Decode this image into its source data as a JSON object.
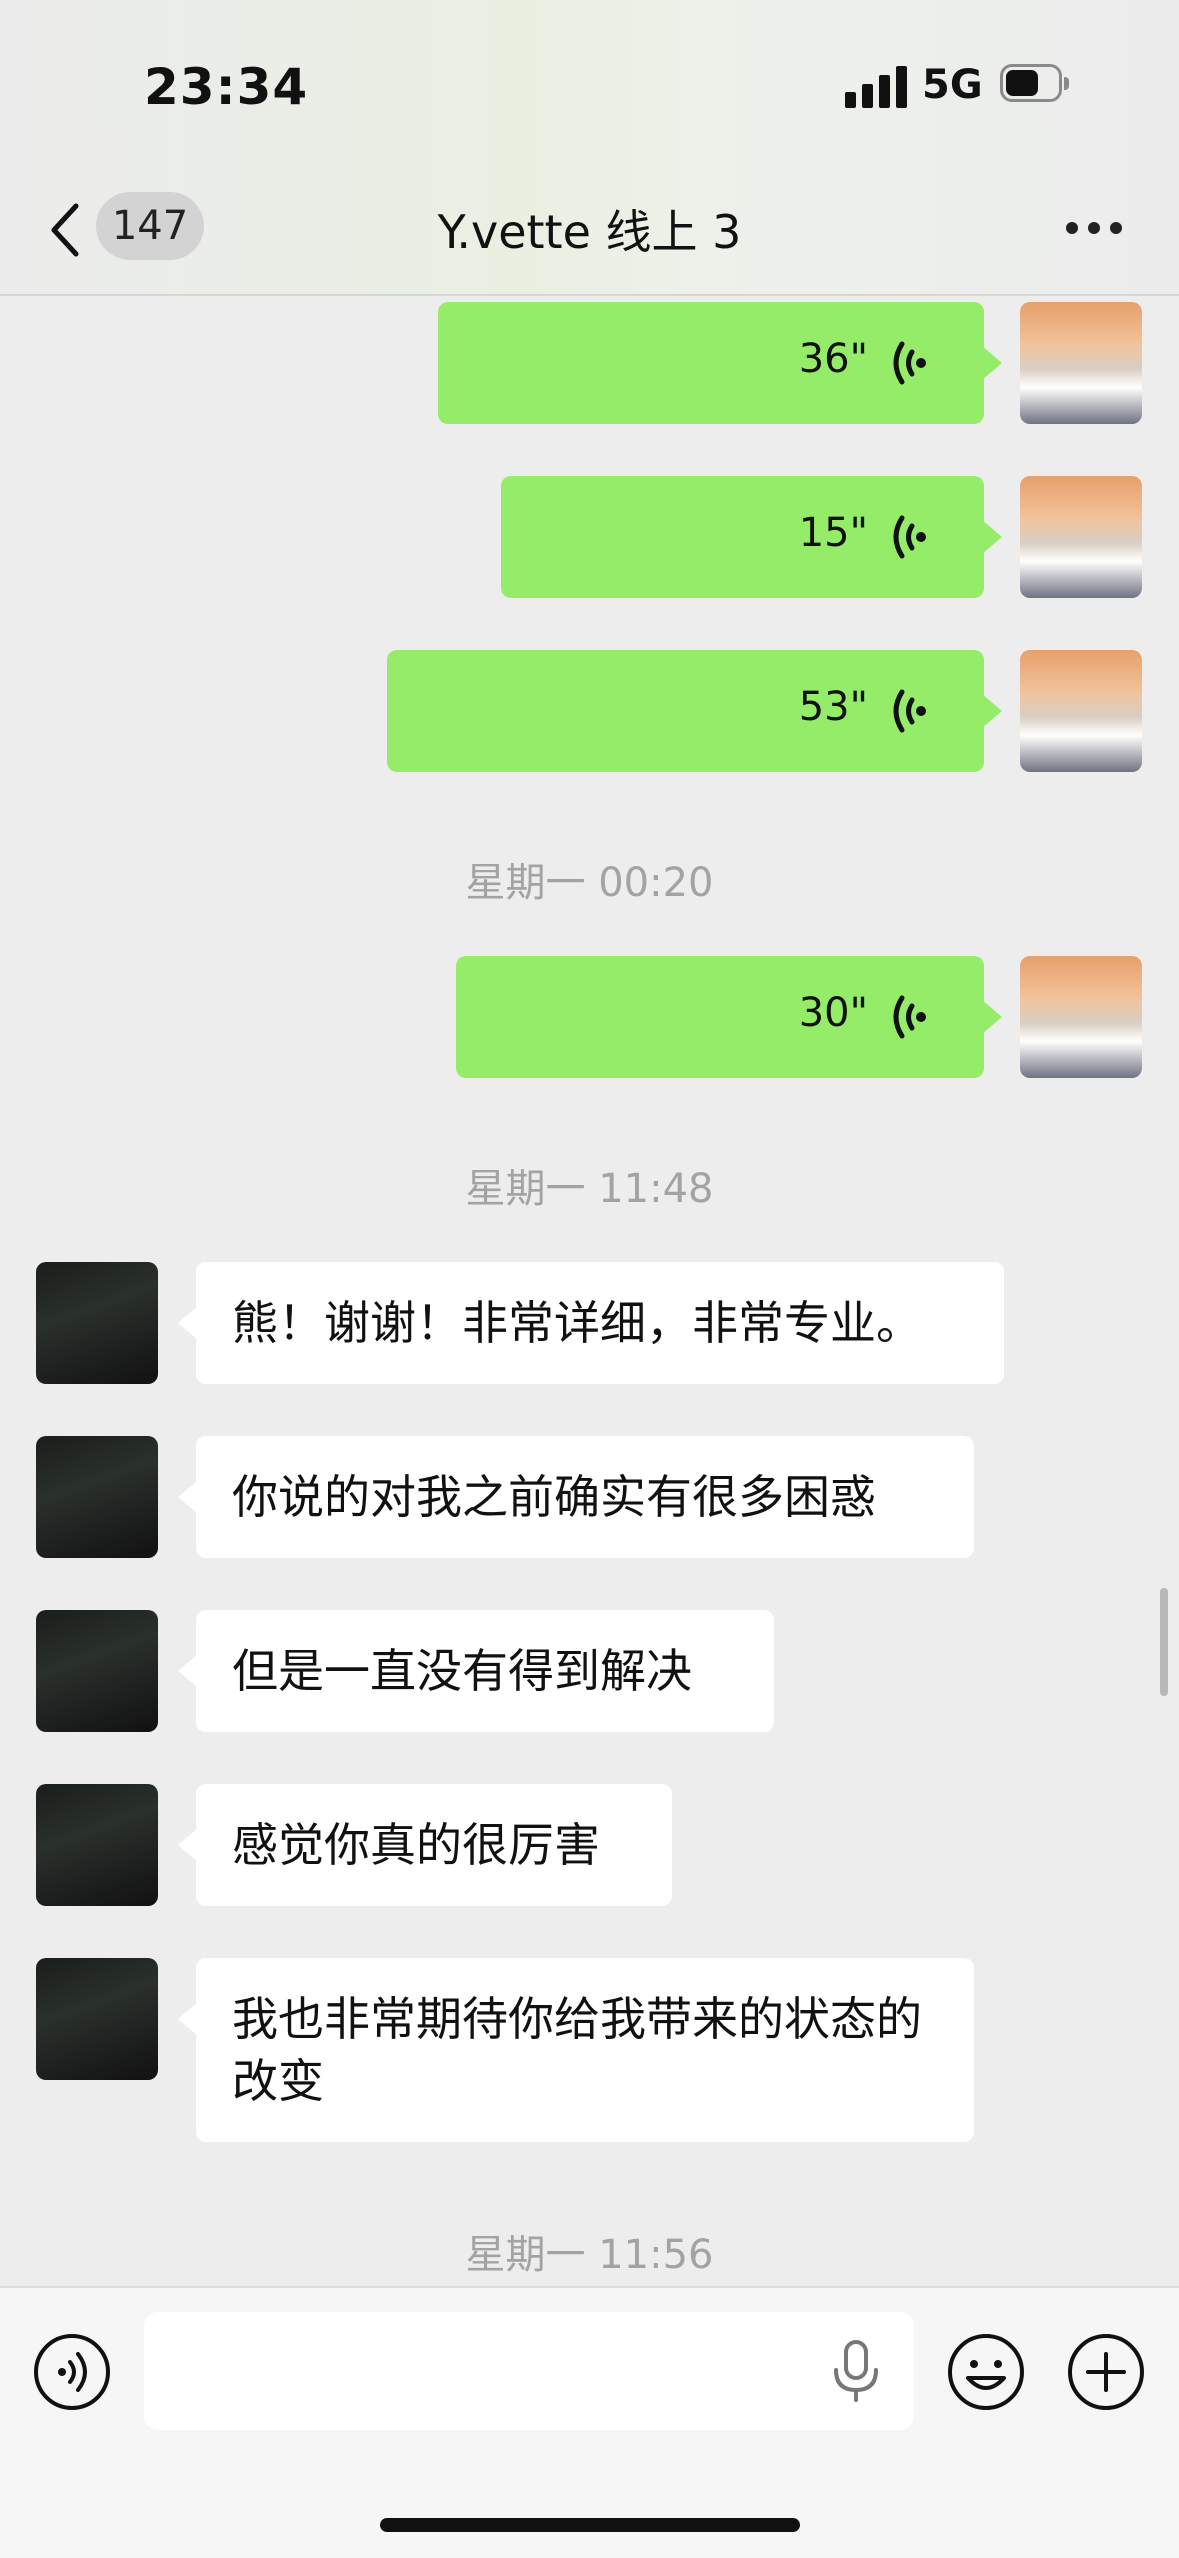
{
  "status": {
    "time": "23:34",
    "network": "5G"
  },
  "nav": {
    "unread_count": "147",
    "title": "Y.vette 线上 3"
  },
  "messages": {
    "voice1": "36\"",
    "voice2": "15\"",
    "voice3": "53\"",
    "time1": "星期一 00:20",
    "voice4": "30\"",
    "time2": "星期一 11:48",
    "text1": "熊！谢谢！非常详细，非常专业。",
    "text2": "你说的对我之前确实有很多困惑",
    "text3": "但是一直没有得到解决",
    "text4": "感觉你真的很厉害",
    "text5": "我也非常期待你给我带来的状态的改变",
    "time3": "星期一 11:56"
  },
  "input": {
    "placeholder": ""
  },
  "colors": {
    "self_bubble": "#95ec69",
    "other_bubble": "#ffffff",
    "background": "#ededed"
  },
  "icons": [
    "back-icon",
    "more-icon",
    "voice-wave-icon",
    "voice-input-icon",
    "mic-icon",
    "emoji-icon",
    "plus-icon",
    "signal-icon",
    "battery-icon"
  ]
}
